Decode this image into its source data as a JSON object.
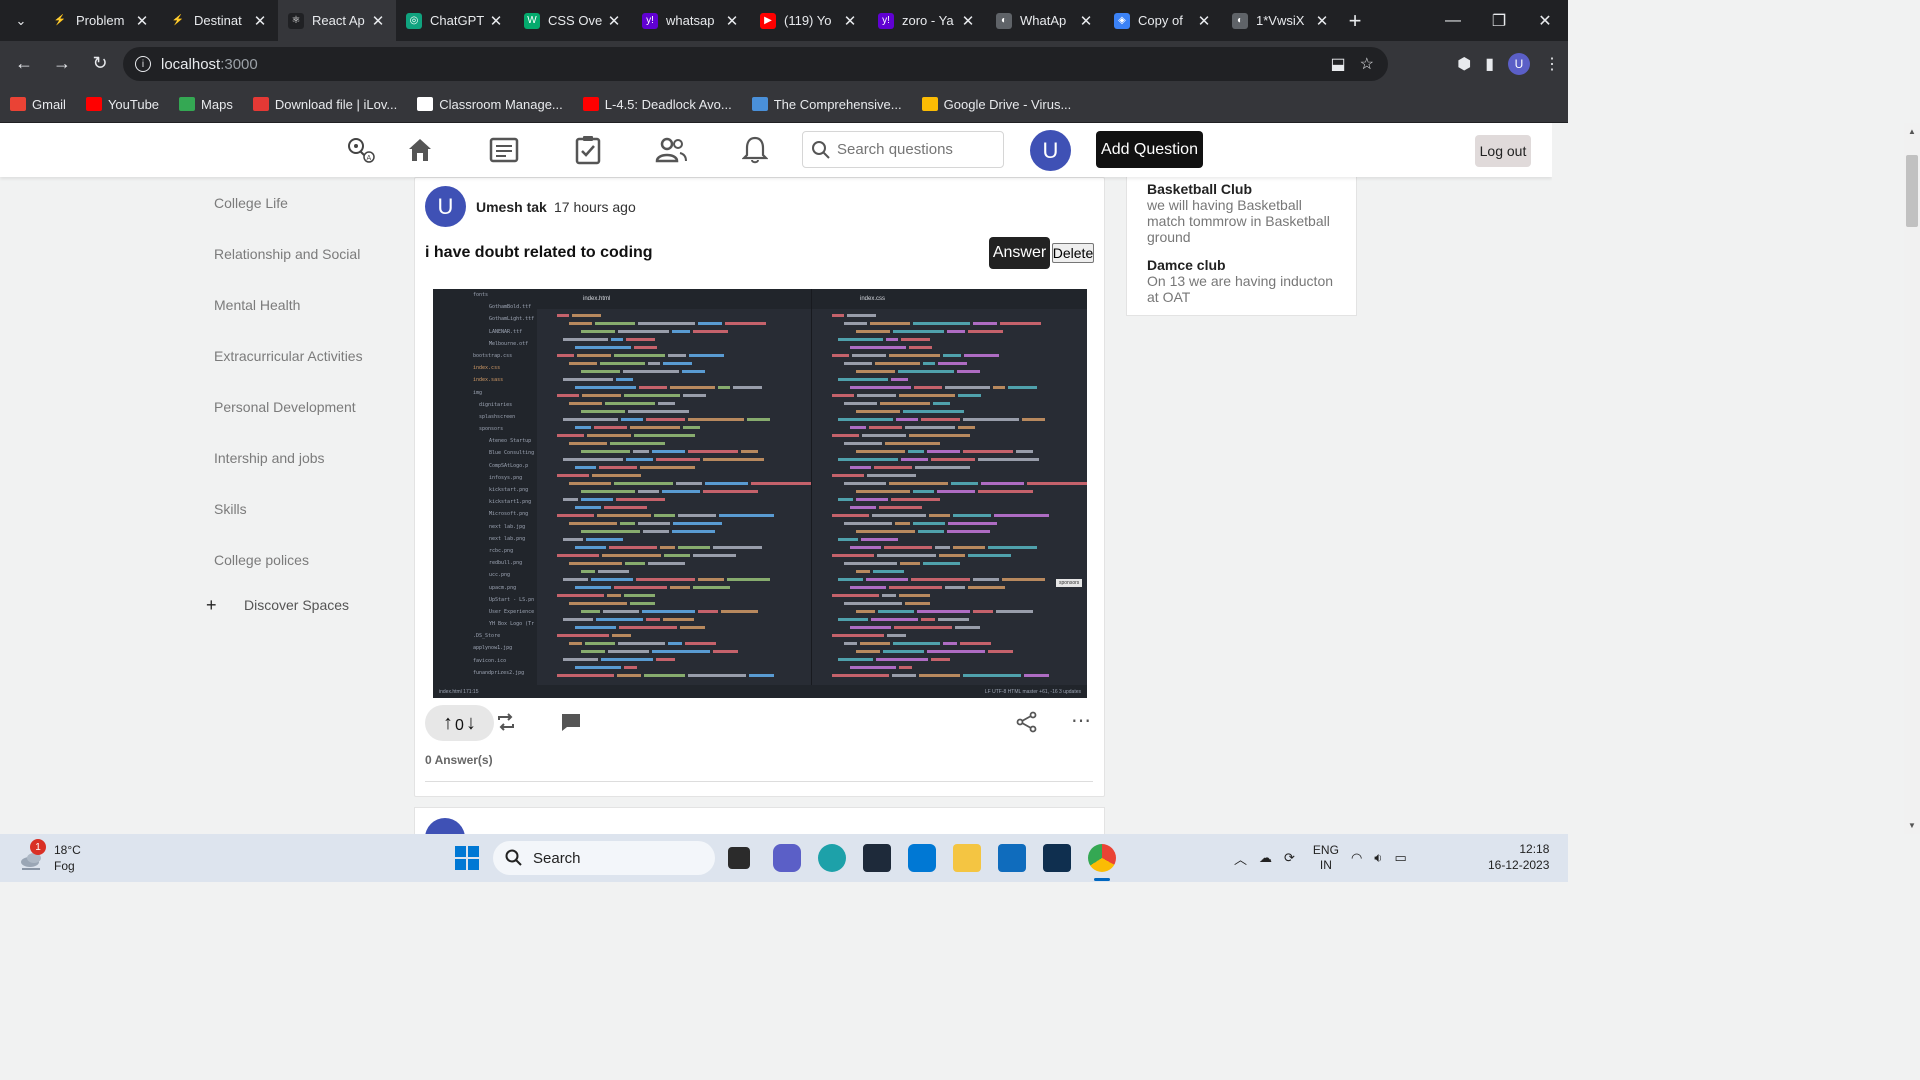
{
  "browser": {
    "tabs": [
      {
        "title": "Problem",
        "icon": "codechef-icon",
        "color": "#202124",
        "glyph": "⚡"
      },
      {
        "title": "Destinat",
        "icon": "codechef-icon",
        "color": "#202124",
        "glyph": "⚡"
      },
      {
        "title": "React Ap",
        "icon": "react-icon",
        "color": "#202124",
        "glyph": "⚛",
        "active": true
      },
      {
        "title": "ChatGPT",
        "icon": "chatgpt-icon",
        "color": "#10a37f",
        "glyph": "◎"
      },
      {
        "title": "CSS Ove",
        "icon": "w3schools-icon",
        "color": "#04aa6d",
        "glyph": "W"
      },
      {
        "title": "whatsap",
        "icon": "yahoo-icon",
        "color": "#6001d2",
        "glyph": "y!"
      },
      {
        "title": "(119) Yo",
        "icon": "youtube-icon",
        "color": "#ff0000",
        "glyph": "▶"
      },
      {
        "title": "zoro - Ya",
        "icon": "yahoo-icon",
        "color": "#6001d2",
        "glyph": "y!"
      },
      {
        "title": "WhatAp",
        "icon": "globe-icon",
        "color": "#5f6368",
        "glyph": "◐"
      },
      {
        "title": "Copy of",
        "icon": "copilot-icon",
        "color": "#3b82f6",
        "glyph": "◈"
      },
      {
        "title": "1*VwsiX",
        "icon": "globe-icon",
        "color": "#5f6368",
        "glyph": "◐"
      }
    ],
    "url_host": "localhost",
    "url_path": ":3000",
    "profile_letter": "U",
    "bookmarks": [
      {
        "label": "Gmail",
        "color": "#ea4335"
      },
      {
        "label": "YouTube",
        "color": "#ff0000"
      },
      {
        "label": "Maps",
        "color": "#34a853"
      },
      {
        "label": "Download file | iLov...",
        "color": "#e53935"
      },
      {
        "label": "Classroom Manage...",
        "color": "#ffffff"
      },
      {
        "label": "L-4.5: Deadlock Avo...",
        "color": "#ff0000"
      },
      {
        "label": "The Comprehensive...",
        "color": "#4a90d9"
      },
      {
        "label": "Google Drive - Virus...",
        "color": "#fbbc04"
      }
    ]
  },
  "header": {
    "search_placeholder": "Search questions",
    "avatar_letter": "U",
    "add_question": "Add Question",
    "logout": "Log out"
  },
  "sidebar": {
    "items": [
      "College Life",
      "Relationship and Social",
      "Mental Health",
      "Extracurricular Activities",
      "Personal Development",
      "Intership and jobs",
      "Skills",
      "College polices"
    ],
    "discover": "Discover Spaces",
    "discover_plus": "+"
  },
  "post": {
    "avatar_letter": "U",
    "user": "Umesh tak",
    "time": "17 hours ago",
    "question": "i have doubt related to coding",
    "answer_btn": "Answer",
    "delete_btn": "Delete",
    "votes": "0",
    "answers": "0 Answer(s)"
  },
  "code_image": {
    "tab1": "index.html",
    "tab2": "index.css",
    "status_left": "index.html    171:15",
    "status_right": "LF   UTF-8   HTML   master   +61, -16   3 updates",
    "tooltip": "sponsors",
    "files": [
      "fonts",
      "GothamBold.ttf",
      "GothamLight.ttf",
      "LANENAR.ttf",
      "Melbourne.otf",
      "bootstrap.css",
      "index.css",
      "index.sass",
      "img",
      "dignitaries",
      "splashscreen",
      "sponsors",
      "Ateneo Startup",
      "Blue Consulting",
      "CompSAtLogo.p",
      "infosys.png",
      "kickstart.png",
      "kickstart1.png",
      "Microsoft.png",
      "next lab.jpg",
      "next lab.png",
      "rcbc.png",
      "redbull.png",
      "ucc.png",
      "upacm.png",
      "UpStart - LS.pn",
      "User Experience",
      "YH Box Logo (Tr",
      ".DS_Store",
      "applynow1.jpg",
      "favicon.ico",
      "funandprizes2.jpg"
    ]
  },
  "widget": {
    "items": [
      {
        "title": "Basketball Club",
        "desc": "we will having Basketball match tommrow in Basketball ground"
      },
      {
        "title": "Damce club",
        "desc": "On 13 we are having inducton at OAT"
      }
    ]
  },
  "taskbar": {
    "temp": "18°C",
    "weather": "Fog",
    "badge": "1",
    "search": "Search",
    "lang1": "ENG",
    "lang2": "IN",
    "time": "12:18",
    "date": "16-12-2023"
  }
}
